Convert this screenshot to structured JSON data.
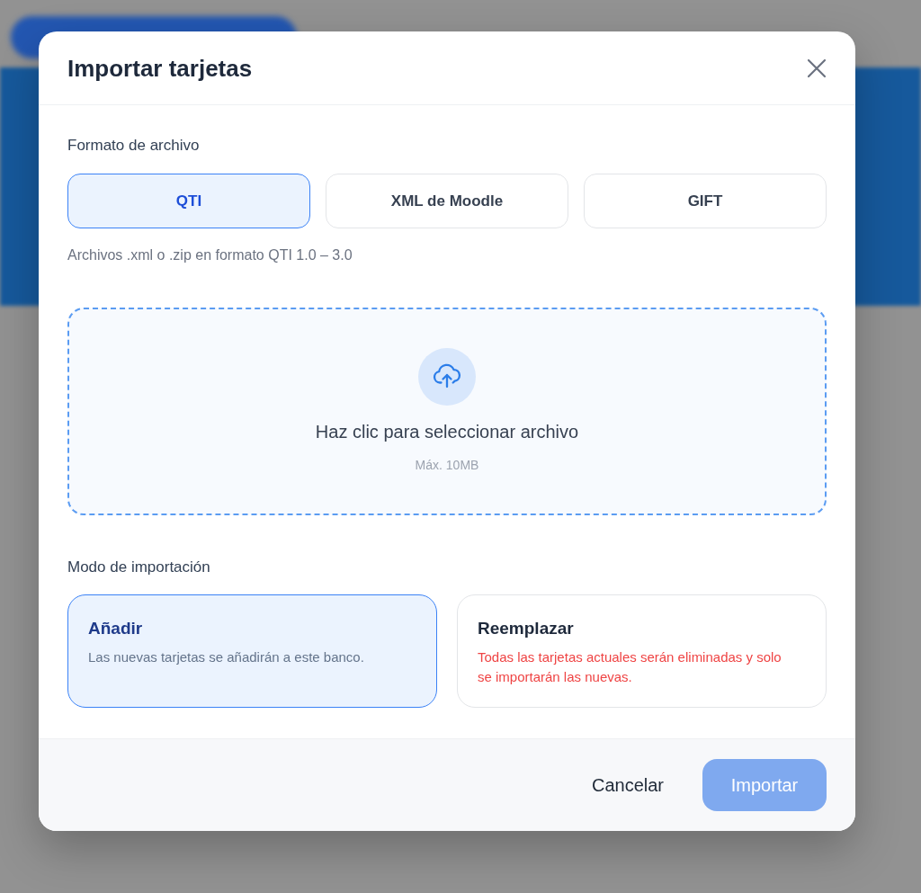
{
  "dialog": {
    "title": "Importar tarjetas"
  },
  "format": {
    "label": "Formato de archivo",
    "options": [
      {
        "label": "QTI",
        "selected": true
      },
      {
        "label": "XML de Moodle",
        "selected": false
      },
      {
        "label": "GIFT",
        "selected": false
      }
    ],
    "hint": "Archivos .xml o .zip en formato QTI 1.0 – 3.0"
  },
  "dropzone": {
    "title": "Haz clic para seleccionar archivo",
    "note": "Máx. 10MB"
  },
  "mode": {
    "label": "Modo de importación",
    "options": [
      {
        "title": "Añadir",
        "description": "Las nuevas tarjetas se añadirán a este banco.",
        "kind": "info",
        "selected": true
      },
      {
        "title": "Reemplazar",
        "description": "Todas las tarjetas actuales serán eliminadas y solo se importarán las nuevas.",
        "kind": "warning",
        "selected": false
      }
    ]
  },
  "footer": {
    "buttons": [
      {
        "label": "Cancelar",
        "kind": "secondary",
        "disabled": false
      },
      {
        "label": "Importar",
        "kind": "primary",
        "disabled": true
      }
    ]
  }
}
